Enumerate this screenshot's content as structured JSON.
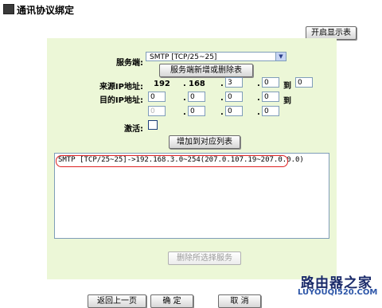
{
  "page": {
    "title": "通讯协议绑定",
    "show_table_button": "开启显示表"
  },
  "form": {
    "server_label": "服务端:",
    "server_value": "SMTP [TCP/25~25]",
    "delete_server_button": "服务端新增或删除表",
    "source_ip_label": "来源IP地址:",
    "source_ip": [
      "192",
      "168",
      "3",
      "0"
    ],
    "source_ip_end": "0",
    "dest_ip_label": "目的IP地址:",
    "dest_ip": [
      "0",
      "0",
      "0",
      "0"
    ],
    "dest_ip_end": [
      "0",
      "0",
      "0",
      "0"
    ],
    "to_label": "到",
    "activate_label": "激活:",
    "add_button": "增加到对应列表"
  },
  "list": {
    "items": [
      "SMTP [TCP/25~25]->192.168.3.0~254(207.0.107.19~207.0.0.0)"
    ]
  },
  "remove_button": "删除所选择服务",
  "footer": {
    "back_button": "返回上一页",
    "ok_button": "确 定",
    "cancel_button": "取 消"
  },
  "watermark": {
    "logo_text": "路由器之家",
    "url": "LUYOUQI520.COM"
  },
  "colors": {
    "panel_bg": "#ecf7d7",
    "highlight": "#dd2222",
    "input_border": "#7f9db9"
  }
}
